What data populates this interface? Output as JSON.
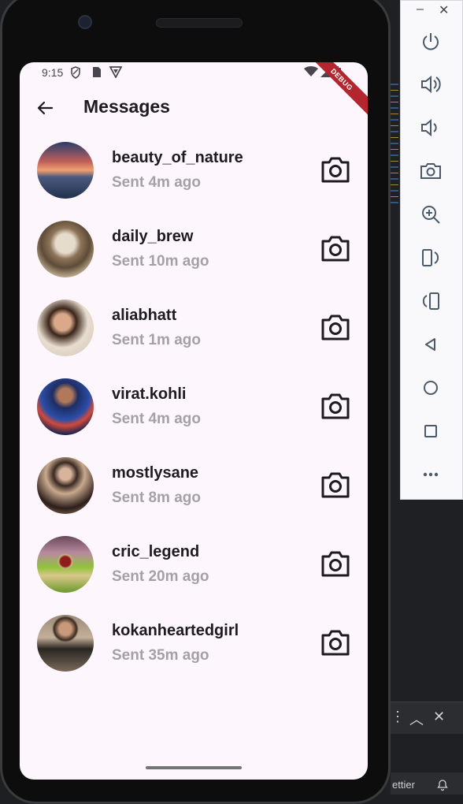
{
  "device": {
    "status_bar": {
      "time": "9:15",
      "debug_label": "DEBUG"
    },
    "app_bar": {
      "title": "Messages"
    }
  },
  "messages": [
    {
      "username": "beauty_of_nature",
      "sent": "Sent 4m ago",
      "avatar": "sunset-sea"
    },
    {
      "username": "daily_brew",
      "sent": "Sent 10m ago",
      "avatar": "coffee-table"
    },
    {
      "username": "aliabhatt",
      "sent": "Sent 1m ago",
      "avatar": "woman-portrait"
    },
    {
      "username": "virat.kohli",
      "sent": "Sent 4m ago",
      "avatar": "cricketer-blue"
    },
    {
      "username": "mostlysane",
      "sent": "Sent 8m ago",
      "avatar": "woman-dark-dress"
    },
    {
      "username": "cric_legend",
      "sent": "Sent 20m ago",
      "avatar": "cricket-ball-pitch"
    },
    {
      "username": "kokanheartedgirl",
      "sent": "Sent 35m ago",
      "avatar": "woman-outdoor"
    }
  ],
  "emulator_panel": {
    "controls": [
      "power-icon",
      "volume-up-icon",
      "volume-down-icon",
      "screenshot-icon",
      "zoom-icon",
      "rotate-left-icon",
      "rotate-right-icon",
      "back-icon",
      "home-icon",
      "overview-icon",
      "more-icon"
    ]
  },
  "ide": {
    "status_text": "ettier"
  },
  "colors": {
    "screen_bg": "#fdf7fd",
    "title": "#1d1b20",
    "subtitle": "#a3a1a6"
  }
}
